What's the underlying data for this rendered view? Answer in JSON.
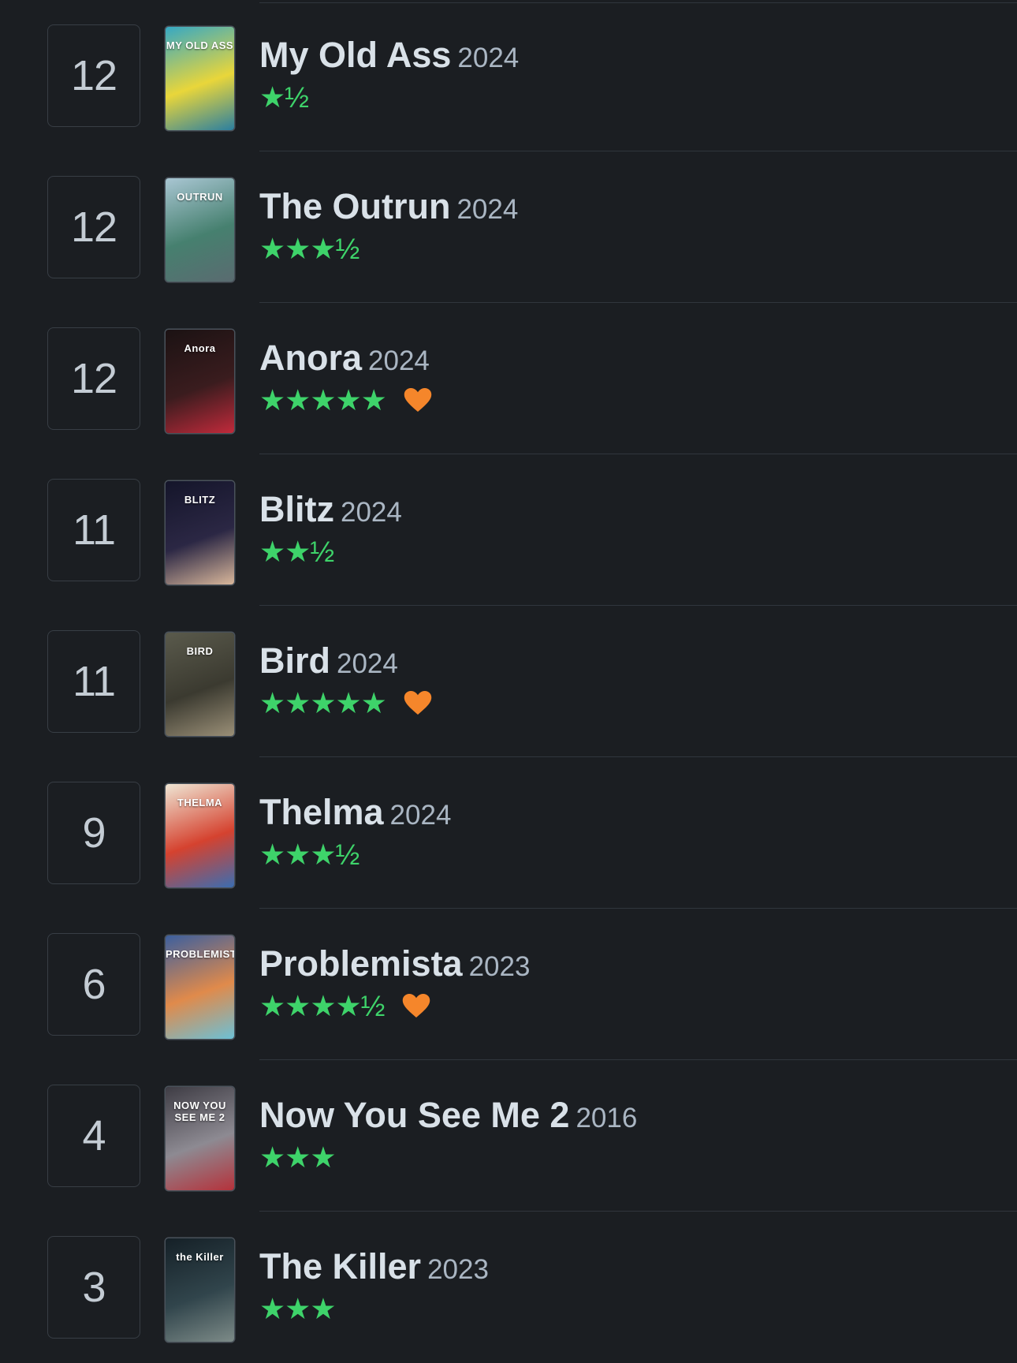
{
  "accent": {
    "star": "#3ed36a",
    "heart": "#f5862b"
  },
  "entries": [
    {
      "day": "12",
      "title": "My Old Ass",
      "year": "2024",
      "rating": "★½",
      "liked": false,
      "poster": {
        "text": "MY OLD ASS",
        "colors": [
          "#36a8c4",
          "#e9d63a",
          "#2b7fa0"
        ],
        "icon": "poster-my-old-ass"
      }
    },
    {
      "day": "12",
      "title": "The Outrun",
      "year": "2024",
      "rating": "★★★½",
      "liked": false,
      "poster": {
        "text": "OUTRUN",
        "colors": [
          "#a9c6d3",
          "#46806f",
          "#5a6b70"
        ],
        "icon": "poster-the-outrun"
      }
    },
    {
      "day": "12",
      "title": "Anora",
      "year": "2024",
      "rating": "★★★★★",
      "liked": true,
      "poster": {
        "text": "Anora",
        "colors": [
          "#1b1213",
          "#3a1c1e",
          "#c12a3b"
        ],
        "icon": "poster-anora"
      }
    },
    {
      "day": "11",
      "title": "Blitz",
      "year": "2024",
      "rating": "★★½",
      "liked": false,
      "poster": {
        "text": "BLITZ",
        "colors": [
          "#14152a",
          "#2b2744",
          "#d9b79b"
        ],
        "icon": "poster-blitz"
      }
    },
    {
      "day": "11",
      "title": "Bird",
      "year": "2024",
      "rating": "★★★★★",
      "liked": true,
      "poster": {
        "text": "BIRD",
        "colors": [
          "#5a5a4c",
          "#3b3a30",
          "#9a8f77"
        ],
        "icon": "poster-bird"
      }
    },
    {
      "day": "9",
      "title": "Thelma",
      "year": "2024",
      "rating": "★★★½",
      "liked": false,
      "poster": {
        "text": "THELMA",
        "colors": [
          "#efe6d4",
          "#d5422f",
          "#3b6db1"
        ],
        "icon": "poster-thelma"
      }
    },
    {
      "day": "6",
      "title": "Problemista",
      "year": "2023",
      "rating": "★★★★½",
      "liked": true,
      "poster": {
        "text": "PROBLEMISTA",
        "colors": [
          "#3c5f9e",
          "#e08a4b",
          "#6cc0d6"
        ],
        "icon": "poster-problemista"
      }
    },
    {
      "day": "4",
      "title": "Now You See Me 2",
      "year": "2016",
      "rating": "★★★",
      "liked": false,
      "poster": {
        "text": "NOW YOU SEE ME 2",
        "colors": [
          "#3e3c44",
          "#8d8a92",
          "#b5323b"
        ],
        "icon": "poster-now-you-see-me-2"
      }
    },
    {
      "day": "3",
      "title": "The Killer",
      "year": "2023",
      "rating": "★★★",
      "liked": false,
      "poster": {
        "text": "the Killer",
        "colors": [
          "#152027",
          "#31454c",
          "#7d8b88"
        ],
        "icon": "poster-the-killer"
      }
    }
  ]
}
